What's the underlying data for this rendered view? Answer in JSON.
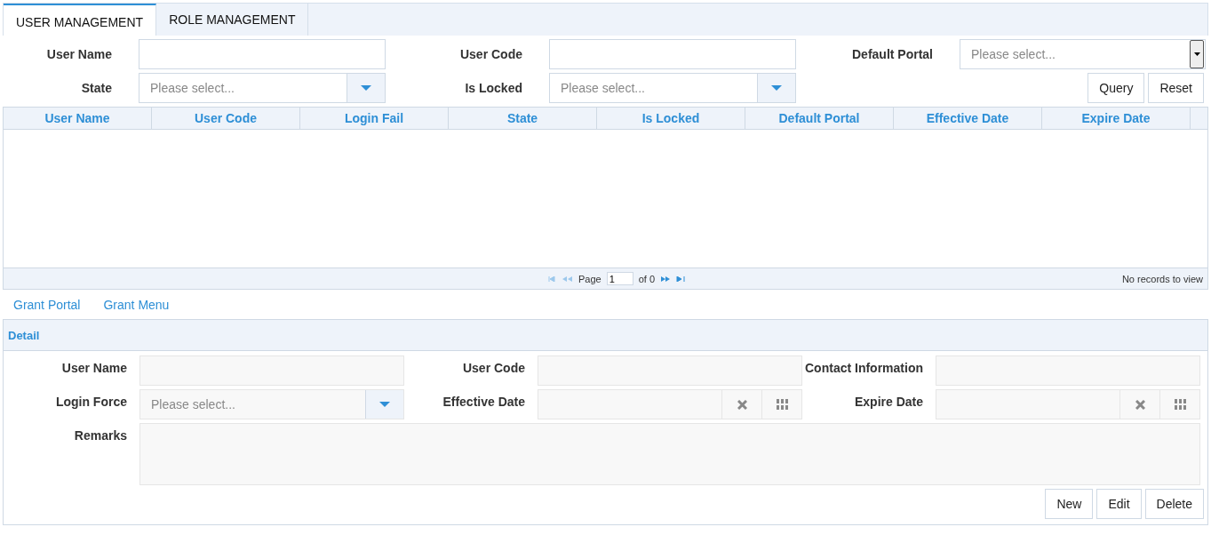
{
  "tabs": [
    {
      "label": "USER MANAGEMENT",
      "selected": true
    },
    {
      "label": "ROLE MANAGEMENT",
      "selected": false
    }
  ],
  "query": {
    "fields": [
      {
        "label": "User Name",
        "kind": "text"
      },
      {
        "label": "User Code",
        "kind": "text"
      },
      {
        "label": "Default Portal",
        "kind": "native-select",
        "placeholder": "Please select..."
      },
      {
        "label": "State",
        "kind": "select",
        "placeholder": "Please select..."
      },
      {
        "label": "Is Locked",
        "kind": "select",
        "placeholder": "Please select..."
      }
    ],
    "buttons": [
      "Query",
      "Reset"
    ]
  },
  "table": {
    "columns": [
      "User Name",
      "User Code",
      "Login Fail",
      "State",
      "Is Locked",
      "Default Portal",
      "Effective Date",
      "Expire Date"
    ],
    "pager": {
      "page_label": "Page",
      "page": "1",
      "of": "of 0",
      "status": "No records to view"
    }
  },
  "links": [
    "Grant Portal",
    "Grant Menu"
  ],
  "detail": {
    "title": "Detail",
    "fields": [
      {
        "label": "User Name",
        "kind": "text"
      },
      {
        "label": "User Code",
        "kind": "text"
      },
      {
        "label": "Contact Information",
        "kind": "text"
      },
      {
        "label": "Login Force",
        "kind": "select",
        "placeholder": "Please select..."
      },
      {
        "label": "Effective Date",
        "kind": "date"
      },
      {
        "label": "Expire Date",
        "kind": "date"
      },
      {
        "label": "Remarks",
        "kind": "textarea"
      }
    ],
    "buttons": [
      "New",
      "Edit",
      "Delete"
    ]
  }
}
